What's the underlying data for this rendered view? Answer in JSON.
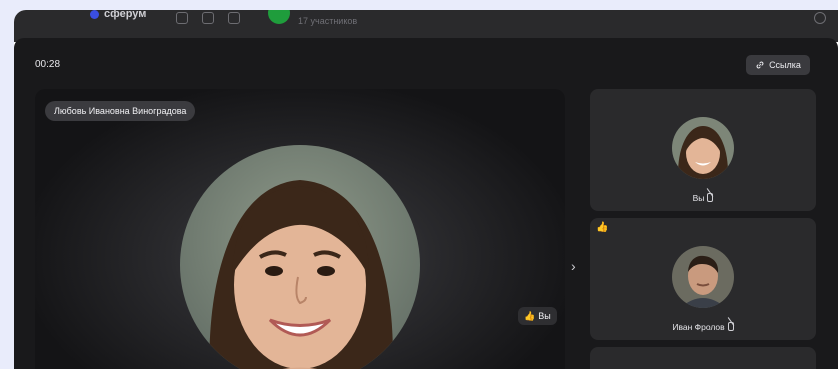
{
  "topbar": {
    "app_name": "сферум",
    "participants": "17 участников"
  },
  "call": {
    "timer": "00:28",
    "link_button": "Ссылка",
    "main_speaker_name": "Любовь Ивановна Виноградова",
    "main_reaction_emoji": "👍",
    "main_reaction_label": "Вы",
    "next_arrow": "›"
  },
  "tiles": [
    {
      "label": "Вы",
      "reaction": ""
    },
    {
      "label": "Иван Фролов",
      "reaction": "👍"
    }
  ],
  "icons": {
    "link": "link-icon",
    "mic_off": "mic-off-icon",
    "thumbs_up": "thumbs-up-icon",
    "chevron_right": "chevron-right-icon"
  },
  "colors": {
    "background": "#e9ecfb",
    "panel": "#19191b",
    "tile": "#2a2a2c",
    "accent_green": "#1f9d3c"
  }
}
